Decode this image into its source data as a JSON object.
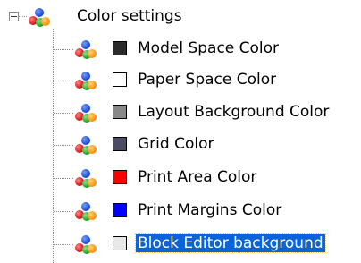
{
  "tree": {
    "root": {
      "label": "Color settings",
      "icon": "color-settings-icon",
      "expanded": true
    },
    "children": [
      {
        "label": "Model Space Color",
        "swatch": "#2b2b2b",
        "icon": "color-settings-icon"
      },
      {
        "label": "Paper Space Color",
        "swatch": "#ffffff",
        "icon": "color-settings-icon"
      },
      {
        "label": "Layout Background Color",
        "swatch": "#888888",
        "icon": "color-settings-icon"
      },
      {
        "label": "Grid Color",
        "swatch": "#4a4a64",
        "icon": "color-settings-icon"
      },
      {
        "label": "Print Area Color",
        "swatch": "#ff0000",
        "icon": "color-settings-icon"
      },
      {
        "label": "Print Margins Color",
        "swatch": "#0000ff",
        "icon": "color-settings-icon"
      },
      {
        "label": "Block Editor background",
        "swatch": "#e8e8e8",
        "icon": "color-settings-icon",
        "selected": true
      }
    ]
  }
}
